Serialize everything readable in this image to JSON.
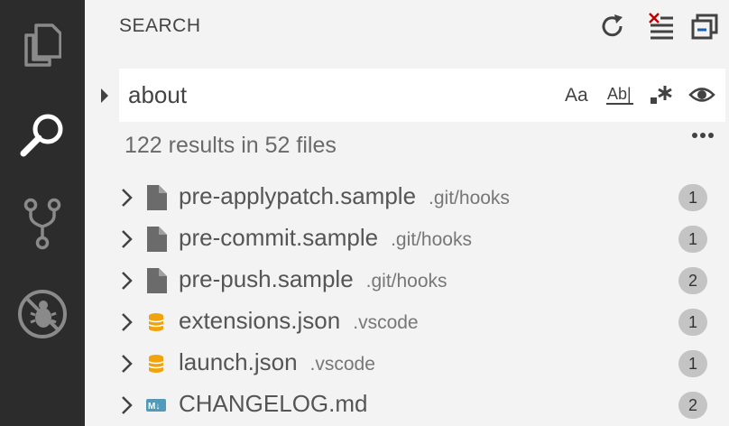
{
  "activity_bar": {
    "items": [
      {
        "name": "explorer",
        "icon": "files-icon"
      },
      {
        "name": "search",
        "icon": "search-icon",
        "active": true
      },
      {
        "name": "source-control",
        "icon": "source-control-icon"
      },
      {
        "name": "debug",
        "icon": "debug-disabled-icon"
      }
    ]
  },
  "sidebar": {
    "title": "SEARCH",
    "actions": [
      "refresh-icon",
      "clear-results-icon",
      "collapse-all-icon"
    ]
  },
  "search": {
    "query": "about",
    "options": [
      "match-case-icon",
      "match-whole-word-icon",
      "use-regex-icon",
      "preview-eye-icon"
    ],
    "summary": "122 results in 52 files"
  },
  "results": [
    {
      "name": "pre-applypatch.sample",
      "path": ".git/hooks",
      "count": "1",
      "icon": "file-icon"
    },
    {
      "name": "pre-commit.sample",
      "path": ".git/hooks",
      "count": "1",
      "icon": "file-icon"
    },
    {
      "name": "pre-push.sample",
      "path": ".git/hooks",
      "count": "2",
      "icon": "file-icon"
    },
    {
      "name": "extensions.json",
      "path": ".vscode",
      "count": "1",
      "icon": "json-icon"
    },
    {
      "name": "launch.json",
      "path": ".vscode",
      "count": "1",
      "icon": "json-icon"
    },
    {
      "name": "CHANGELOG.md",
      "path": "",
      "count": "2",
      "icon": "markdown-icon"
    }
  ],
  "colors": {
    "activity_bg": "#2c2c2c",
    "sidebar_bg": "#f3f3f3",
    "json_icon": "#f0a30a",
    "markdown_icon": "#519aba",
    "clear_x": "#c00000"
  }
}
